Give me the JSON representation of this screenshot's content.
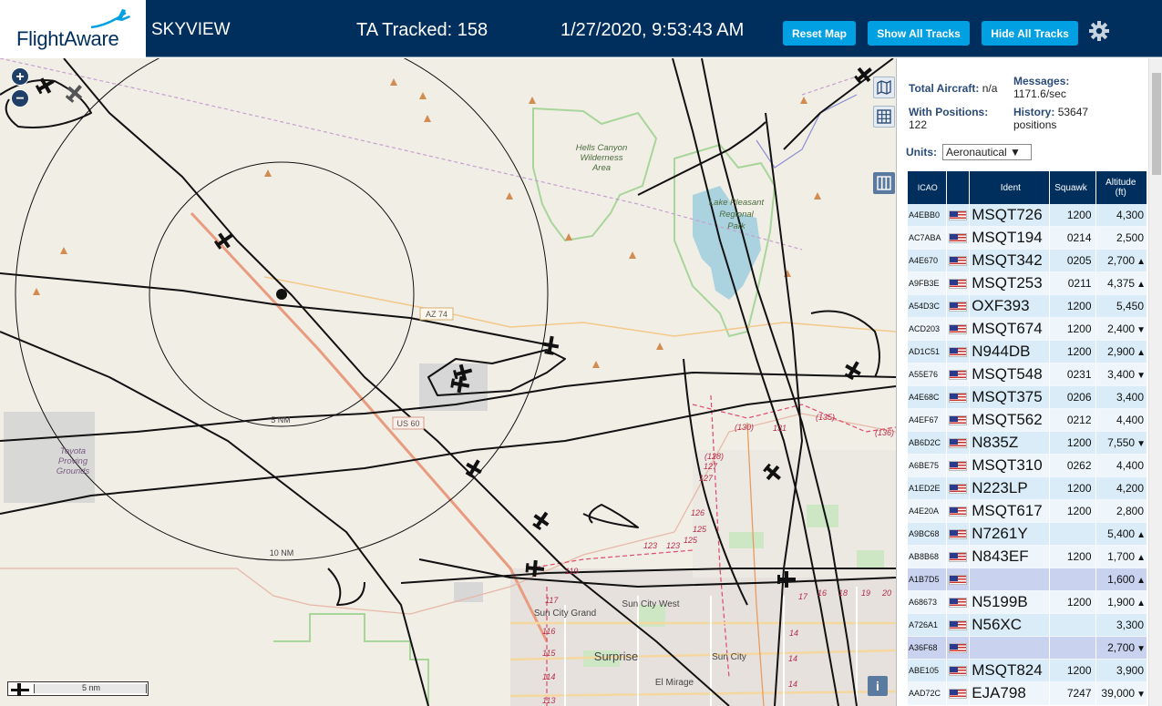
{
  "header": {
    "logo_text": "FlightAware",
    "app_title": "SKYVIEW",
    "tracked": "TA Tracked: 158",
    "datetime": "1/27/2020, 9:53:43 AM",
    "buttons": {
      "reset": "Reset Map",
      "show_all": "Show All Tracks",
      "hide_all": "Hide All Tracks"
    },
    "settings_icon": "gear-icon",
    "colors": {
      "bar": "#002f5d",
      "button": "#00a0e2"
    }
  },
  "map": {
    "zoom_in": "+",
    "zoom_out": "−",
    "range_rings": [
      "5 NM",
      "10 NM"
    ],
    "labels": {
      "hells_canyon": [
        "Hells Canyon",
        "Wilderness",
        "Area"
      ],
      "lake_pleasant": [
        "Lake Pleasant",
        "Regional",
        "Park"
      ],
      "toyota": [
        "Toyota",
        "Proving",
        "Grounds"
      ],
      "sun_city_grand": "Sun City Grand",
      "sun_city_west": "Sun City West",
      "sun_city": "Sun City",
      "surprise": "Surprise",
      "el_mirage": "El Mirage",
      "az74": "AZ 74",
      "us60": "US 60"
    },
    "road_numbers": [
      "(135)",
      "131",
      "(130)",
      "(128)",
      "127",
      "127",
      "126",
      "125",
      "125",
      "123",
      "123",
      "119",
      "117",
      "116",
      "115",
      "114",
      "113",
      "(136)",
      "17",
      "16",
      "18",
      "19",
      "20",
      "14",
      "14",
      "14"
    ],
    "scale_label": "5 nm",
    "info_label": "i",
    "controls": [
      "map-icon",
      "grid-icon",
      "columns-icon"
    ]
  },
  "panel": {
    "total_aircraft_label": "Total Aircraft:",
    "total_aircraft_value": "n/a",
    "with_positions_label": "With Positions:",
    "with_positions_value": "122",
    "messages_label": "Messages:",
    "messages_value": "1171.6/sec",
    "history_label": "History:",
    "history_value": "53647",
    "history_unit": "positions",
    "units_label": "Units:",
    "units_value": "Aeronautical ▼",
    "columns": {
      "icao": "ICAO",
      "ident": "Ident",
      "squawk": "Squawk",
      "altitude": "Altitude",
      "altitude_unit": "(ft)"
    },
    "rows": [
      {
        "icao": "A4EBB0",
        "ident": "MSQT726",
        "squawk": "1200",
        "altitude": "4,300",
        "dir": ""
      },
      {
        "icao": "AC7ABA",
        "ident": "MSQT194",
        "squawk": "0214",
        "altitude": "2,500",
        "dir": ""
      },
      {
        "icao": "A4E670",
        "ident": "MSQT342",
        "squawk": "0205",
        "altitude": "2,700",
        "dir": "▲"
      },
      {
        "icao": "A9FB3E",
        "ident": "MSQT253",
        "squawk": "0211",
        "altitude": "4,375",
        "dir": "▲"
      },
      {
        "icao": "A54D3C",
        "ident": "OXF393",
        "squawk": "1200",
        "altitude": "5,450",
        "dir": ""
      },
      {
        "icao": "ACD203",
        "ident": "MSQT674",
        "squawk": "1200",
        "altitude": "2,400",
        "dir": "▼"
      },
      {
        "icao": "AD1C51",
        "ident": "N944DB",
        "squawk": "1200",
        "altitude": "2,900",
        "dir": "▲"
      },
      {
        "icao": "A55E76",
        "ident": "MSQT548",
        "squawk": "0231",
        "altitude": "3,400",
        "dir": "▼"
      },
      {
        "icao": "A4E68C",
        "ident": "MSQT375",
        "squawk": "0206",
        "altitude": "3,400",
        "dir": ""
      },
      {
        "icao": "A4EF67",
        "ident": "MSQT562",
        "squawk": "0212",
        "altitude": "4,400",
        "dir": ""
      },
      {
        "icao": "AB6D2C",
        "ident": "N835Z",
        "squawk": "1200",
        "altitude": "7,550",
        "dir": "▼"
      },
      {
        "icao": "A6BE75",
        "ident": "MSQT310",
        "squawk": "0262",
        "altitude": "4,400",
        "dir": ""
      },
      {
        "icao": "A1ED2E",
        "ident": "N223LP",
        "squawk": "1200",
        "altitude": "4,200",
        "dir": ""
      },
      {
        "icao": "A4E20A",
        "ident": "MSQT617",
        "squawk": "1200",
        "altitude": "2,800",
        "dir": ""
      },
      {
        "icao": "A9BC68",
        "ident": "N7261Y",
        "squawk": "",
        "altitude": "5,400",
        "dir": "▲"
      },
      {
        "icao": "AB8B68",
        "ident": "N843EF",
        "squawk": "1200",
        "altitude": "1,700",
        "dir": "▲"
      },
      {
        "icao": "A1B7D5",
        "ident": "",
        "squawk": "",
        "altitude": "1,600",
        "dir": "▲"
      },
      {
        "icao": "A68673",
        "ident": "N5199B",
        "squawk": "1200",
        "altitude": "1,900",
        "dir": "▲"
      },
      {
        "icao": "A726A1",
        "ident": "N56XC",
        "squawk": "",
        "altitude": "3,300",
        "dir": ""
      },
      {
        "icao": "A36F68",
        "ident": "",
        "squawk": "",
        "altitude": "2,700",
        "dir": "▼"
      },
      {
        "icao": "ABE105",
        "ident": "MSQT824",
        "squawk": "1200",
        "altitude": "3,900",
        "dir": ""
      },
      {
        "icao": "AAD72C",
        "ident": "EJA798",
        "squawk": "7247",
        "altitude": "39,000",
        "dir": "▼"
      }
    ]
  }
}
